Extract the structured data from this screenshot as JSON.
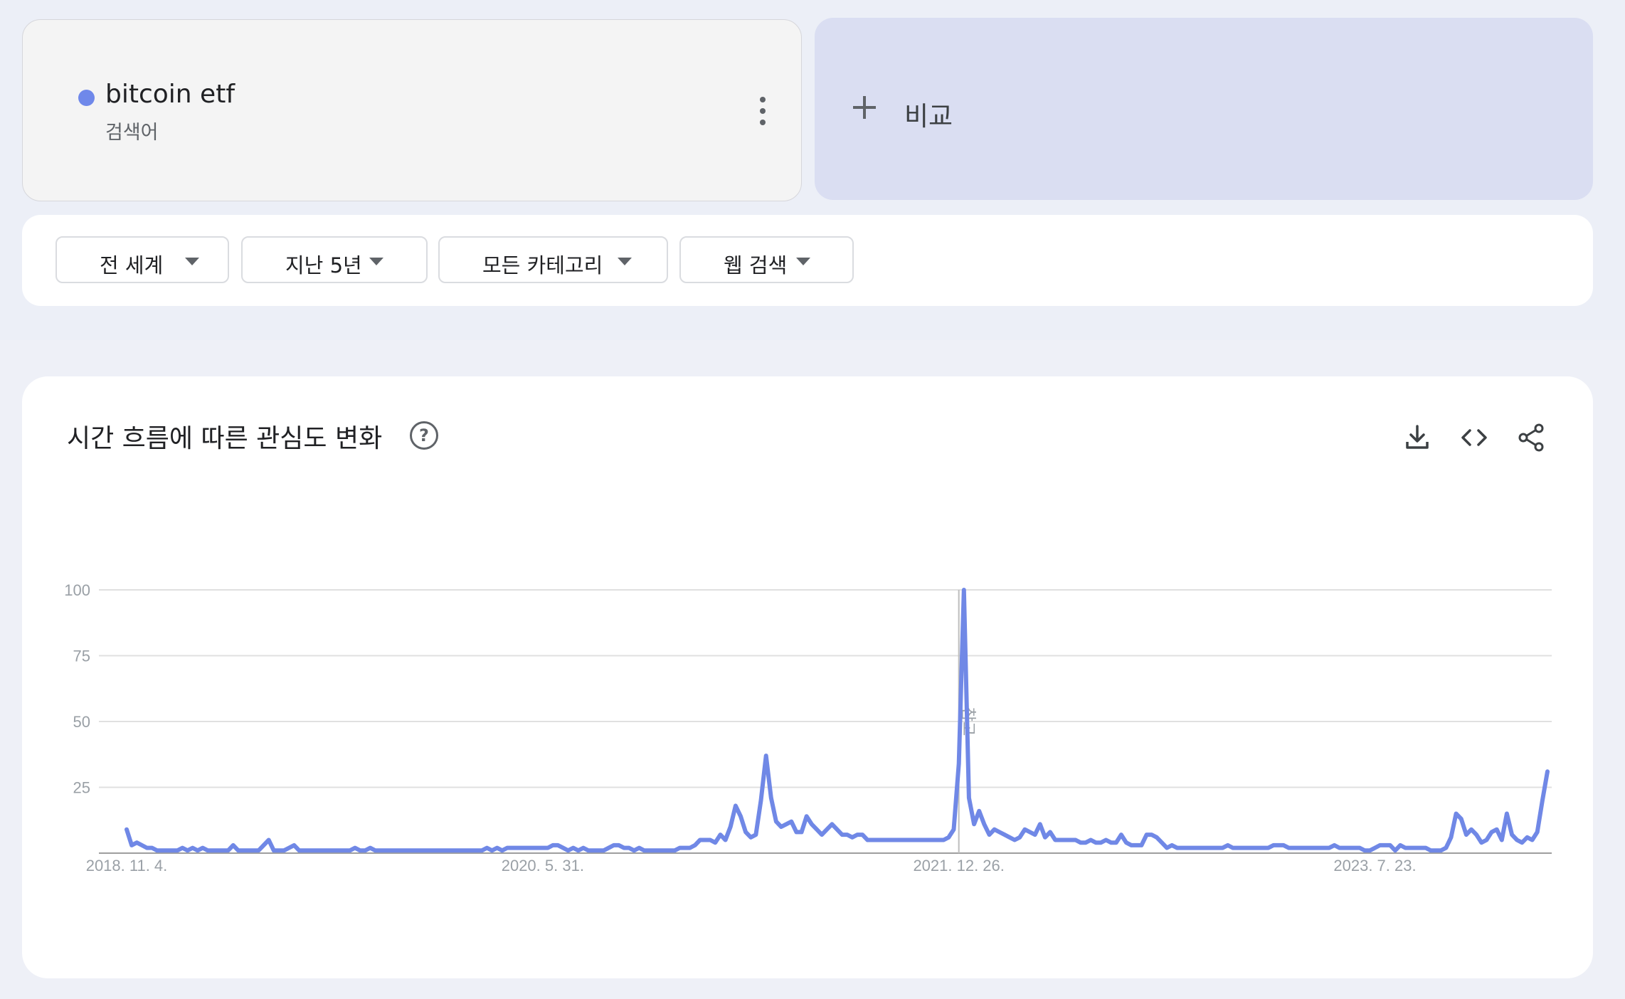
{
  "term": {
    "name": "bitcoin etf",
    "type_label": "검색어",
    "dot_color": "#6f88ea"
  },
  "compare": {
    "label": "비교"
  },
  "filters": [
    {
      "label": "전 세계"
    },
    {
      "label": "지난 5년"
    },
    {
      "label": "모든 카테고리"
    },
    {
      "label": "웹 검색"
    }
  ],
  "panel": {
    "title": "시간 흐름에 따른 관심도 변화",
    "icons": [
      "help-icon",
      "download-icon",
      "embed-code-icon",
      "share-icon"
    ]
  },
  "chart_data": {
    "type": "line",
    "title": "시간 흐름에 따른 관심도 변화",
    "ylim": [
      0,
      100
    ],
    "yticks": [
      25,
      50,
      75,
      100
    ],
    "x_ticks": [
      {
        "label": "2018. 11. 4.",
        "week": 0
      },
      {
        "label": "2020. 5. 31.",
        "week": 82
      },
      {
        "label": "2021. 12. 26.",
        "week": 164
      },
      {
        "label": "2023. 7. 23.",
        "week": 246
      }
    ],
    "annotation": {
      "label": "참고",
      "week": 164
    },
    "series_color": "#7088e6",
    "grid": true,
    "series": [
      {
        "name": "bitcoin etf",
        "values": [
          9,
          3,
          4,
          3,
          2,
          2,
          1,
          1,
          1,
          1,
          1,
          2,
          1,
          2,
          1,
          2,
          1,
          1,
          1,
          1,
          1,
          3,
          1,
          1,
          1,
          1,
          1,
          3,
          5,
          1,
          1,
          1,
          2,
          3,
          1,
          1,
          1,
          1,
          1,
          1,
          1,
          1,
          1,
          1,
          1,
          2,
          1,
          1,
          2,
          1,
          1,
          1,
          1,
          1,
          1,
          1,
          1,
          1,
          1,
          1,
          1,
          1,
          1,
          1,
          1,
          1,
          1,
          1,
          1,
          1,
          1,
          2,
          1,
          2,
          1,
          2,
          2,
          2,
          2,
          2,
          2,
          2,
          2,
          2,
          3,
          3,
          2,
          1,
          2,
          1,
          2,
          1,
          1,
          1,
          1,
          2,
          3,
          3,
          2,
          2,
          1,
          2,
          1,
          1,
          1,
          1,
          1,
          1,
          1,
          2,
          2,
          2,
          3,
          5,
          5,
          5,
          4,
          7,
          5,
          10,
          18,
          14,
          8,
          6,
          7,
          20,
          37,
          21,
          12,
          10,
          11,
          12,
          8,
          8,
          14,
          11,
          9,
          7,
          9,
          11,
          9,
          7,
          7,
          6,
          7,
          7,
          5,
          5,
          5,
          5,
          5,
          5,
          5,
          5,
          5,
          5,
          5,
          5,
          5,
          5,
          5,
          5,
          6,
          9,
          34,
          100,
          21,
          11,
          16,
          11,
          7,
          9,
          8,
          7,
          6,
          5,
          6,
          9,
          8,
          7,
          11,
          6,
          8,
          5,
          5,
          5,
          5,
          5,
          4,
          4,
          5,
          4,
          4,
          5,
          4,
          4,
          7,
          4,
          3,
          3,
          3,
          7,
          7,
          6,
          4,
          2,
          3,
          2,
          2,
          2,
          2,
          2,
          2,
          2,
          2,
          2,
          2,
          3,
          2,
          2,
          2,
          2,
          2,
          2,
          2,
          2,
          3,
          3,
          3,
          2,
          2,
          2,
          2,
          2,
          2,
          2,
          2,
          2,
          3,
          2,
          2,
          2,
          2,
          2,
          1,
          1,
          2,
          3,
          3,
          3,
          1,
          3,
          2,
          2,
          2,
          2,
          2,
          1,
          1,
          1,
          2,
          6,
          15,
          13,
          7,
          9,
          7,
          4,
          5,
          8,
          9,
          5,
          15,
          7,
          5,
          4,
          6,
          5,
          8,
          20,
          31
        ]
      }
    ]
  }
}
